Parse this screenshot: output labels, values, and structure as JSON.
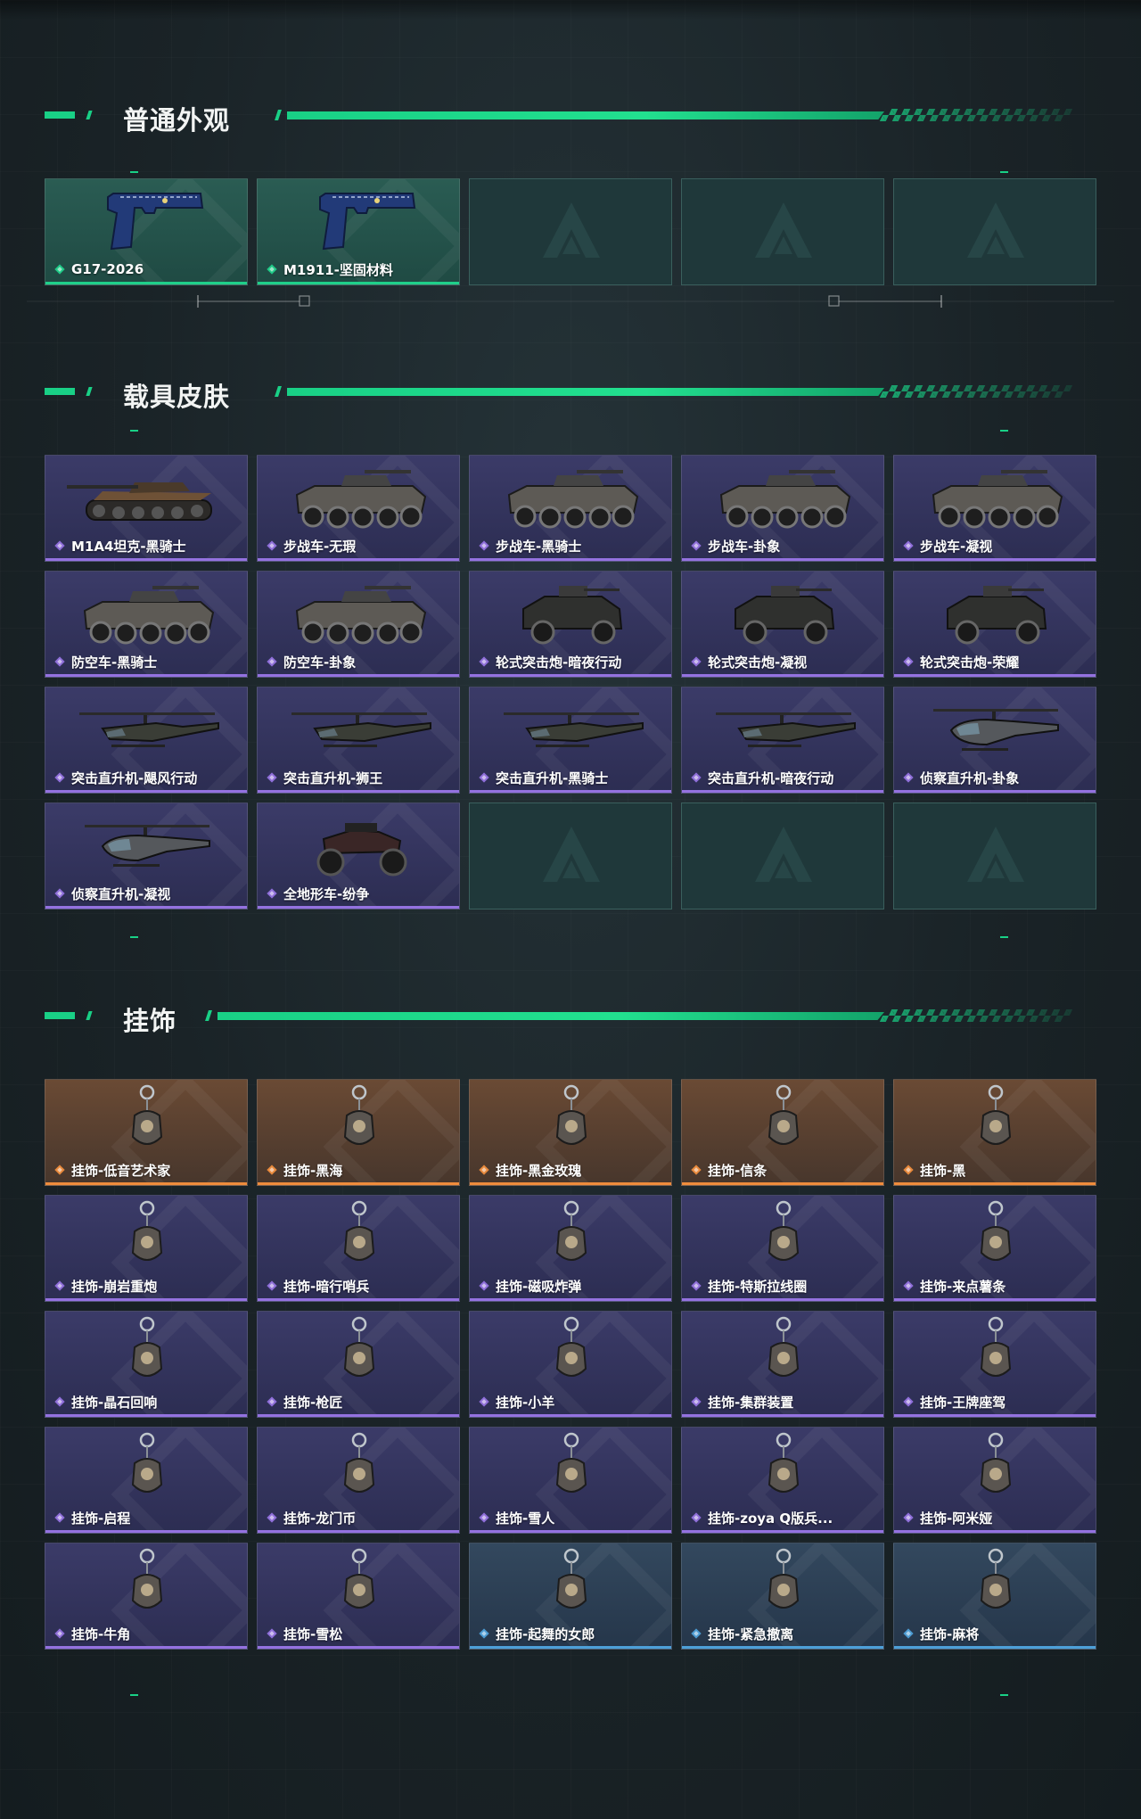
{
  "colors": {
    "accent": "#19d086",
    "rarity_green": "#1fd08a",
    "rarity_purple": "#9472e0",
    "rarity_orange": "#ef8c3c",
    "rarity_blue": "#4d9fd8"
  },
  "sections": [
    {
      "title": "普通外观",
      "items": [
        {
          "label": "G17-2026",
          "rarity": "green",
          "icon": "pistol-icon"
        },
        {
          "label": "M1911-坚固材料",
          "rarity": "green",
          "icon": "pistol-icon"
        },
        {
          "label": "",
          "rarity": "empty"
        },
        {
          "label": "",
          "rarity": "empty"
        },
        {
          "label": "",
          "rarity": "empty"
        }
      ]
    },
    {
      "title": "载具皮肤",
      "items": [
        {
          "label": "M1A4坦克-黑骑士",
          "rarity": "purple",
          "icon": "tank-icon"
        },
        {
          "label": "步战车-无瑕",
          "rarity": "purple",
          "icon": "apc-icon"
        },
        {
          "label": "步战车-黑骑士",
          "rarity": "purple",
          "icon": "apc-icon"
        },
        {
          "label": "步战车-卦象",
          "rarity": "purple",
          "icon": "apc-icon"
        },
        {
          "label": "步战车-凝视",
          "rarity": "purple",
          "icon": "apc-icon"
        },
        {
          "label": "防空车-黑骑士",
          "rarity": "purple",
          "icon": "apc-icon"
        },
        {
          "label": "防空车-卦象",
          "rarity": "purple",
          "icon": "apc-icon"
        },
        {
          "label": "轮式突击炮-暗夜行动",
          "rarity": "purple",
          "icon": "armored-car-icon"
        },
        {
          "label": "轮式突击炮-凝视",
          "rarity": "purple",
          "icon": "armored-car-icon"
        },
        {
          "label": "轮式突击炮-荣耀",
          "rarity": "purple",
          "icon": "armored-car-icon"
        },
        {
          "label": "突击直升机-飓风行动",
          "rarity": "purple",
          "icon": "helicopter-icon"
        },
        {
          "label": "突击直升机-狮王",
          "rarity": "purple",
          "icon": "helicopter-icon"
        },
        {
          "label": "突击直升机-黑骑士",
          "rarity": "purple",
          "icon": "helicopter-icon"
        },
        {
          "label": "突击直升机-暗夜行动",
          "rarity": "purple",
          "icon": "helicopter-icon"
        },
        {
          "label": "侦察直升机-卦象",
          "rarity": "purple",
          "icon": "scout-helicopter-icon"
        },
        {
          "label": "侦察直升机-凝视",
          "rarity": "purple",
          "icon": "scout-helicopter-icon"
        },
        {
          "label": "全地形车-纷争",
          "rarity": "purple",
          "icon": "atv-icon"
        },
        {
          "label": "",
          "rarity": "empty"
        },
        {
          "label": "",
          "rarity": "empty"
        },
        {
          "label": "",
          "rarity": "empty"
        }
      ]
    },
    {
      "title": "挂饰",
      "items": [
        {
          "label": "挂饰-低音艺术家",
          "rarity": "orange",
          "icon": "charm-icon"
        },
        {
          "label": "挂饰-黑海",
          "rarity": "orange",
          "icon": "charm-icon"
        },
        {
          "label": "挂饰-黑金玫瑰",
          "rarity": "orange",
          "icon": "charm-icon"
        },
        {
          "label": "挂饰-信条",
          "rarity": "orange",
          "icon": "charm-icon"
        },
        {
          "label": "挂饰-黑",
          "rarity": "orange",
          "icon": "charm-icon"
        },
        {
          "label": "挂饰-崩岩重炮",
          "rarity": "purple",
          "icon": "charm-icon"
        },
        {
          "label": "挂饰-暗行哨兵",
          "rarity": "purple",
          "icon": "charm-icon"
        },
        {
          "label": "挂饰-磁吸炸弹",
          "rarity": "purple",
          "icon": "charm-icon"
        },
        {
          "label": "挂饰-特斯拉线圈",
          "rarity": "purple",
          "icon": "charm-icon"
        },
        {
          "label": "挂饰-来点薯条",
          "rarity": "purple",
          "icon": "charm-icon"
        },
        {
          "label": "挂饰-晶石回响",
          "rarity": "purple",
          "icon": "charm-icon"
        },
        {
          "label": "挂饰-枪匠",
          "rarity": "purple",
          "icon": "charm-icon"
        },
        {
          "label": "挂饰-小羊",
          "rarity": "purple",
          "icon": "charm-icon"
        },
        {
          "label": "挂饰-集群装置",
          "rarity": "purple",
          "icon": "charm-icon"
        },
        {
          "label": "挂饰-王牌座驾",
          "rarity": "purple",
          "icon": "charm-icon"
        },
        {
          "label": "挂饰-启程",
          "rarity": "purple",
          "icon": "charm-icon"
        },
        {
          "label": "挂饰-龙门币",
          "rarity": "purple",
          "icon": "charm-icon"
        },
        {
          "label": "挂饰-雪人",
          "rarity": "purple",
          "icon": "charm-icon"
        },
        {
          "label": "挂饰-zoya Q版兵...",
          "rarity": "purple",
          "icon": "charm-icon"
        },
        {
          "label": "挂饰-阿米娅",
          "rarity": "purple",
          "icon": "charm-icon"
        },
        {
          "label": "挂饰-牛角",
          "rarity": "purple",
          "icon": "charm-icon"
        },
        {
          "label": "挂饰-雪松",
          "rarity": "purple",
          "icon": "charm-icon"
        },
        {
          "label": "挂饰-起舞的女郎",
          "rarity": "blue",
          "icon": "charm-icon"
        },
        {
          "label": "挂饰-紧急撤离",
          "rarity": "blue",
          "icon": "charm-icon"
        },
        {
          "label": "挂饰-麻将",
          "rarity": "blue",
          "icon": "charm-icon"
        }
      ]
    }
  ]
}
